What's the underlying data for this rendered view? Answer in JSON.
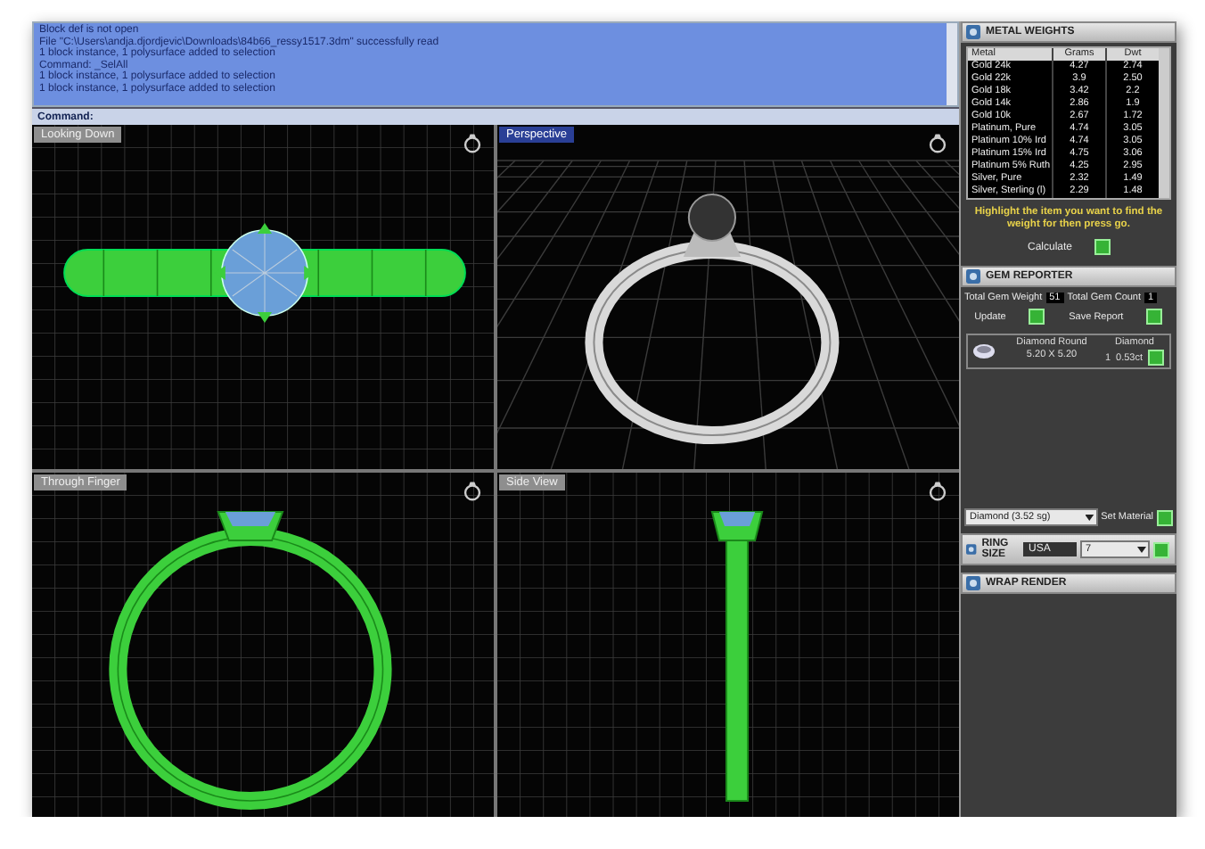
{
  "command_log": {
    "lines": [
      "Block def is not open",
      "File \"C:\\Users\\andja.djordjevic\\Downloads\\84b66_ressy1517.3dm\" successfully read",
      "1 block instance, 1 polysurface added to selection",
      "Command: _SelAll",
      "1 block instance, 1 polysurface added to selection",
      "1 block instance, 1 polysurface added to selection"
    ],
    "prompt": "Command:"
  },
  "viewports": [
    {
      "title": "Looking Down",
      "kind": "top",
      "selected": false
    },
    {
      "title": "Perspective",
      "kind": "perspective",
      "selected": true
    },
    {
      "title": "Through Finger",
      "kind": "front",
      "selected": false
    },
    {
      "title": "Side View",
      "kind": "side",
      "selected": false
    }
  ],
  "metal_weights": {
    "title": "METAL WEIGHTS",
    "columns": [
      "Metal",
      "Grams",
      "Dwt"
    ],
    "rows": [
      [
        "Gold 24k",
        "4.27",
        "2.74"
      ],
      [
        "Gold 22k",
        "3.9",
        "2.50"
      ],
      [
        "Gold 18k",
        "3.42",
        "2.2"
      ],
      [
        "Gold 14k",
        "2.86",
        "1.9"
      ],
      [
        "Gold 10k",
        "2.67",
        "1.72"
      ],
      [
        "Platinum, Pure",
        "4.74",
        "3.05"
      ],
      [
        "Platinum 10% Ird",
        "4.74",
        "3.05"
      ],
      [
        "Platinum 15% Ird",
        "4.75",
        "3.06"
      ],
      [
        "Platinum 5% Ruth",
        "4.25",
        "2.95"
      ],
      [
        "Silver, Pure",
        "2.32",
        "1.49"
      ],
      [
        "Silver, Sterling (l)",
        "2.29",
        "1.48"
      ]
    ],
    "hint": "Highlight the item you want to find the weight for then press go.",
    "calculate": "Calculate"
  },
  "gem_reporter": {
    "title": "GEM REPORTER",
    "weight_label": "Total Gem Weight",
    "weight_value": "51",
    "count_label": "Total Gem Count",
    "count_value": "1",
    "update": "Update",
    "save_report": "Save Report",
    "gems": [
      {
        "name": "Diamond Round",
        "size": "5.20 X 5.20",
        "material": "Diamond",
        "count": "1",
        "weight": "0.53ct"
      }
    ]
  },
  "material": {
    "value": "Diamond (3.52 sg)",
    "button": "Set Material"
  },
  "ring_size": {
    "title": "RING SIZE",
    "system": "USA",
    "size": "7"
  },
  "wrap_render": {
    "title": "WRAP RENDER"
  }
}
